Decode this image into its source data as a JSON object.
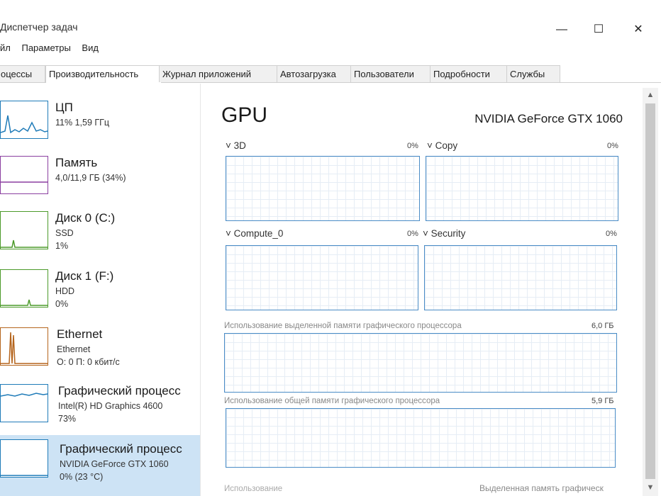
{
  "window": {
    "title": "Диспетчер задач",
    "minimize": "—",
    "maximize": "☐",
    "close": "✕"
  },
  "menu": [
    "йл",
    "Параметры",
    "Вид"
  ],
  "tabs": [
    "оцессы",
    "Производительность",
    "Журнал приложений",
    "Автозагрузка",
    "Пользователи",
    "Подробности",
    "Службы"
  ],
  "sidebar": [
    {
      "title": "ЦП",
      "line1": "11% 1,59 ГГц",
      "line2": ""
    },
    {
      "title": "Память",
      "line1": "4,0/11,9 ГБ (34%)",
      "line2": ""
    },
    {
      "title": "Диск 0 (C:)",
      "line1": "SSD",
      "line2": "1%"
    },
    {
      "title": "Диск 1 (F:)",
      "line1": "HDD",
      "line2": "0%"
    },
    {
      "title": "Ethernet",
      "line1": "Ethernet",
      "line2": "О: 0 П: 0 кбит/с"
    },
    {
      "title": "Графический процесс",
      "line1": "Intel(R) HD Graphics 4600",
      "line2": "73%"
    },
    {
      "title": "Графический процесс",
      "line1": "NVIDIA GeForce GTX 1060",
      "line2": "0% (23 °C)"
    }
  ],
  "main": {
    "title": "GPU",
    "device": "NVIDIA GeForce GTX 1060",
    "engines": [
      {
        "label": "3D",
        "pct": "0%"
      },
      {
        "label": "Copy",
        "pct": "0%"
      },
      {
        "label": "Compute_0",
        "pct": "0%"
      },
      {
        "label": "Security",
        "pct": "0%"
      }
    ],
    "dedicated_label": "Использование выделенной памяти графического процессора",
    "dedicated_value": "6,0 ГБ",
    "shared_label": "Использование общей памяти графического процессора",
    "shared_value": "5,9 ГБ",
    "bottom_left": "Использование",
    "bottom_right": "Выделенная память графическ"
  },
  "colors": {
    "cpu": "#1f7bb8",
    "memory": "#8b3fa0",
    "disk": "#4c9a2a",
    "ethernet": "#b5651d",
    "gpu": "#1f7bb8",
    "selected": "#cde3f5"
  }
}
